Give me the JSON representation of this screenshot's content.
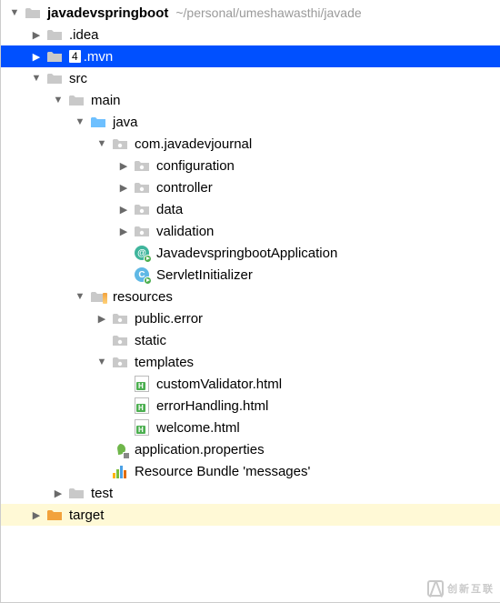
{
  "rows": [
    {
      "depth": 0,
      "arrow": "down",
      "icon": "folder-gray",
      "label": "javadevspringboot",
      "suffix": "~/personal/umeshawasthi/javade",
      "bold": true
    },
    {
      "depth": 1,
      "arrow": "right",
      "icon": "folder-gray",
      "label": ".idea"
    },
    {
      "depth": 1,
      "arrow": "right",
      "icon": "folder-gray",
      "label": ".mvn",
      "selected": true,
      "countMarker": "4"
    },
    {
      "depth": 1,
      "arrow": "down",
      "icon": "folder-gray",
      "label": "src"
    },
    {
      "depth": 2,
      "arrow": "down",
      "icon": "folder-gray",
      "label": "main"
    },
    {
      "depth": 3,
      "arrow": "down",
      "icon": "folder-blue",
      "label": "java"
    },
    {
      "depth": 4,
      "arrow": "down",
      "icon": "folder-pkg",
      "label": "com.javadevjournal"
    },
    {
      "depth": 5,
      "arrow": "right",
      "icon": "folder-pkg",
      "label": "configuration"
    },
    {
      "depth": 5,
      "arrow": "right",
      "icon": "folder-pkg",
      "label": "controller"
    },
    {
      "depth": 5,
      "arrow": "right",
      "icon": "folder-pkg",
      "label": "data"
    },
    {
      "depth": 5,
      "arrow": "right",
      "icon": "folder-pkg",
      "label": "validation"
    },
    {
      "depth": 5,
      "arrow": "none",
      "icon": "class-run-teal",
      "label": "JavadevspringbootApplication"
    },
    {
      "depth": 5,
      "arrow": "none",
      "icon": "class-run-blue",
      "label": "ServletInitializer"
    },
    {
      "depth": 3,
      "arrow": "down",
      "icon": "folder-res",
      "label": "resources"
    },
    {
      "depth": 4,
      "arrow": "right",
      "icon": "folder-pkg",
      "label": "public.error"
    },
    {
      "depth": 4,
      "arrow": "none",
      "icon": "folder-pkg",
      "label": "static"
    },
    {
      "depth": 4,
      "arrow": "down",
      "icon": "folder-pkg",
      "label": "templates"
    },
    {
      "depth": 5,
      "arrow": "none",
      "icon": "html",
      "label": "customValidator.html"
    },
    {
      "depth": 5,
      "arrow": "none",
      "icon": "html",
      "label": "errorHandling.html"
    },
    {
      "depth": 5,
      "arrow": "none",
      "icon": "html",
      "label": "welcome.html"
    },
    {
      "depth": 4,
      "arrow": "none",
      "icon": "leaf",
      "label": "application.properties"
    },
    {
      "depth": 4,
      "arrow": "none",
      "icon": "bundle",
      "label": "Resource Bundle 'messages'"
    },
    {
      "depth": 2,
      "arrow": "right",
      "icon": "folder-gray",
      "label": "test"
    },
    {
      "depth": 1,
      "arrow": "right",
      "icon": "folder-orange",
      "label": "target",
      "targetHl": true
    }
  ],
  "watermark": "创新互联"
}
